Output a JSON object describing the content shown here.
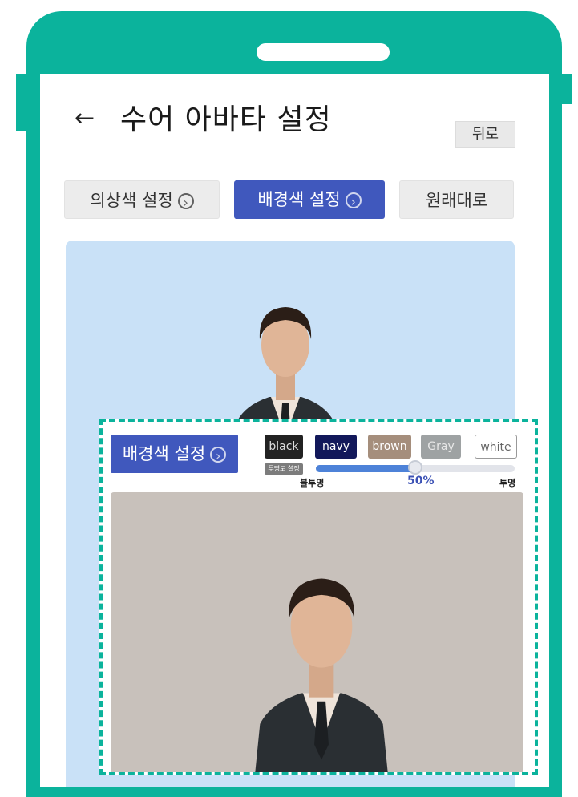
{
  "header": {
    "back_arrow": "←",
    "title": "수어 아바타 설정",
    "back_button": "뒤로"
  },
  "tabs": [
    {
      "label": "의상색 설정",
      "icon": "chevron-right-circle-icon"
    },
    {
      "label": "배경색 설정",
      "icon": "chevron-right-circle-icon"
    },
    {
      "label": "원래대로"
    }
  ],
  "zoom_panel": {
    "bg_button_label": "배경색 설정",
    "colors": [
      {
        "label": "black",
        "color": "#222222"
      },
      {
        "label": "navy",
        "color": "#12185a"
      },
      {
        "label": "brown",
        "color": "#a58e7c"
      },
      {
        "label": "Gray",
        "color": "#9ea2a3"
      },
      {
        "label": "white",
        "color": "#ffffff"
      }
    ],
    "opacity_label": "투명도 설정",
    "slider": {
      "min_label": "불투명",
      "max_label": "투명",
      "value_text": "50%",
      "value": 0.5
    }
  },
  "colors": {
    "accent_teal": "#0bb39c",
    "primary_blue": "#4058bd",
    "preview_bg": "#c9e1f7",
    "preview_bg_zoom": "#c8c1bb"
  }
}
